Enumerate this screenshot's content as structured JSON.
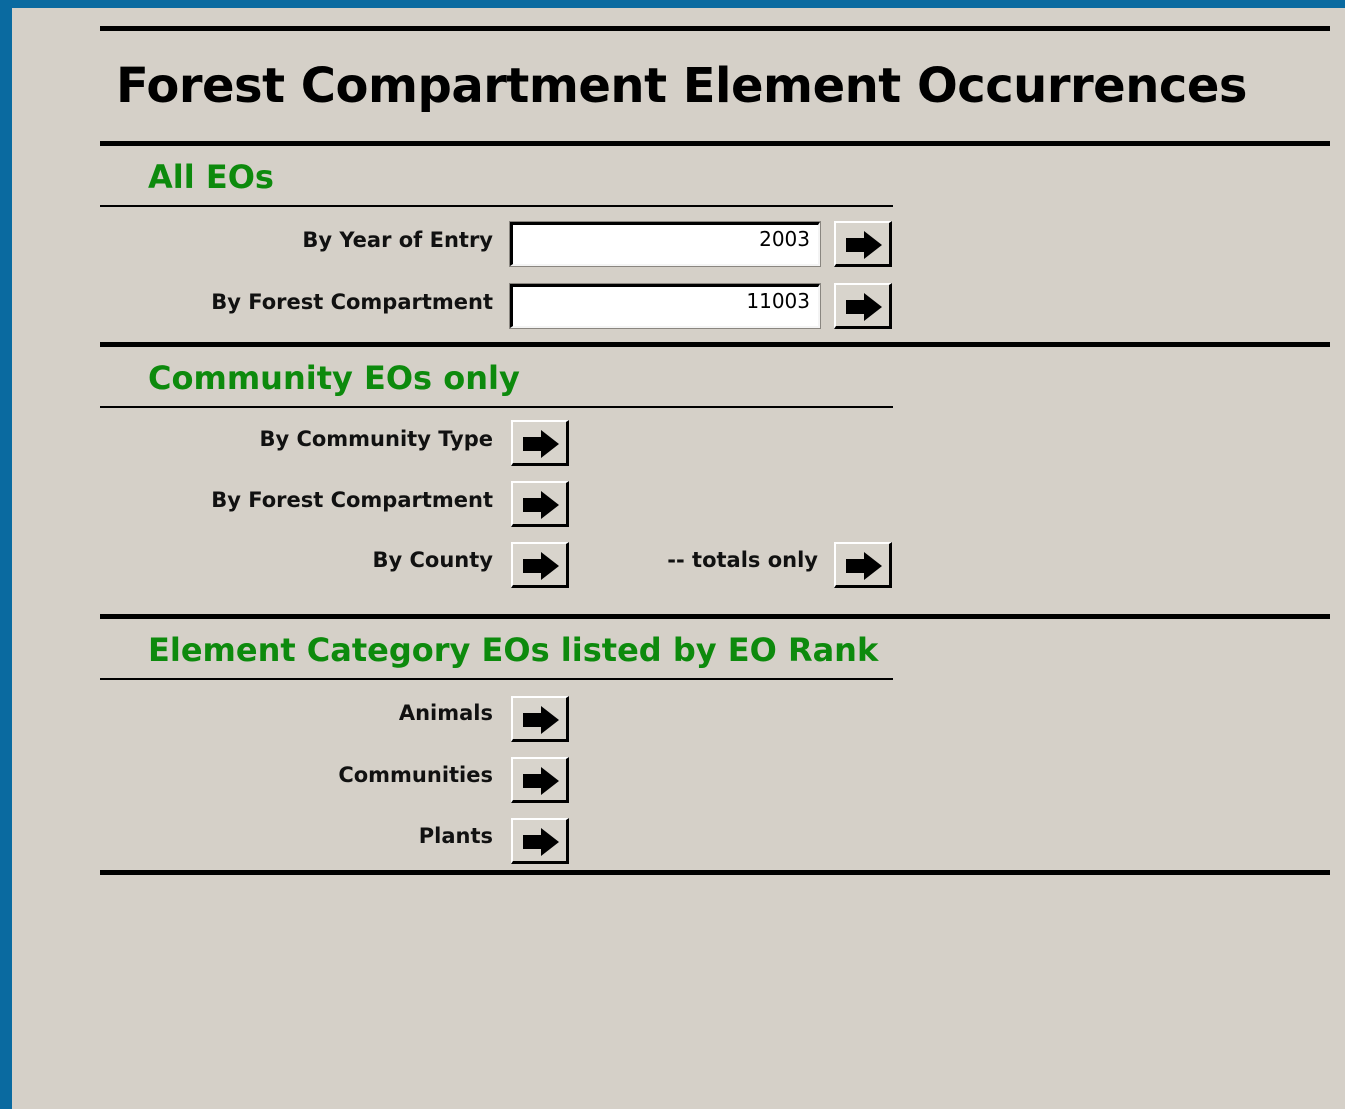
{
  "page": {
    "title": "Forest Compartment Element Occurrences"
  },
  "sections": {
    "all_eos": {
      "heading": "All EOs",
      "year_label": "By Year of Entry",
      "year_value": "2003",
      "compartment_label": "By Forest Compartment",
      "compartment_value": "11003"
    },
    "community_eos": {
      "heading": "Community EOs only",
      "type_label": "By Community Type",
      "compartment_label": "By Forest Compartment",
      "county_label": "By County",
      "totals_label": "-- totals only"
    },
    "element_category": {
      "heading": "Element Category EOs listed by EO Rank",
      "animals_label": "Animals",
      "communities_label": "Communities",
      "plants_label": "Plants"
    }
  },
  "icons": {
    "go_button_icon": "arrow-right-icon"
  },
  "colors": {
    "background": "#d5d0c8",
    "frame": "#0a6aa0",
    "section_heading": "#0d8a0d"
  }
}
